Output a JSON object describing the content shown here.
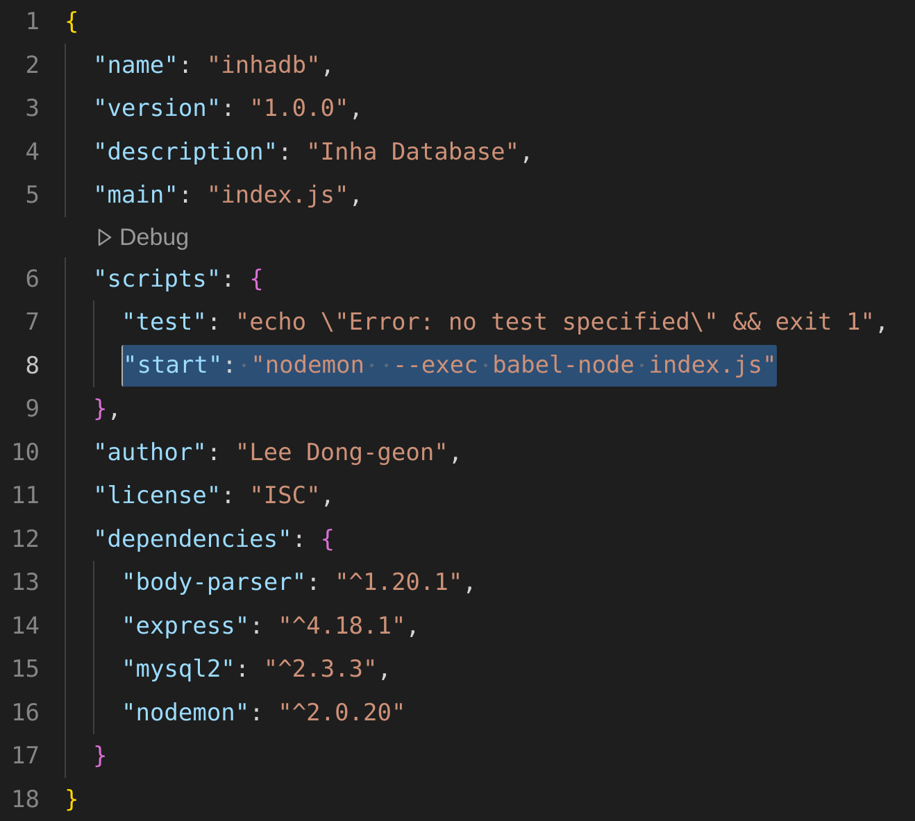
{
  "editor": {
    "file_language": "json",
    "active_line": 8,
    "codelens": {
      "after_line": 5,
      "icon": "play-outline-icon",
      "label": "Debug"
    },
    "colors": {
      "background": "#1e1e1e",
      "key": "#9cdcfe",
      "string": "#ce9178",
      "selection": "#2c4f76"
    },
    "lines": [
      {
        "n": "1",
        "indent": 0,
        "tokens": [
          {
            "t": "{",
            "c": "brace1"
          }
        ]
      },
      {
        "n": "2",
        "indent": 1,
        "tokens": [
          {
            "t": "\"name\"",
            "c": "key"
          },
          {
            "t": ": ",
            "c": "punct"
          },
          {
            "t": "\"inhadb\"",
            "c": "str"
          },
          {
            "t": ",",
            "c": "punct"
          }
        ]
      },
      {
        "n": "3",
        "indent": 1,
        "tokens": [
          {
            "t": "\"version\"",
            "c": "key"
          },
          {
            "t": ": ",
            "c": "punct"
          },
          {
            "t": "\"1.0.0\"",
            "c": "str"
          },
          {
            "t": ",",
            "c": "punct"
          }
        ]
      },
      {
        "n": "4",
        "indent": 1,
        "tokens": [
          {
            "t": "\"description\"",
            "c": "key"
          },
          {
            "t": ": ",
            "c": "punct"
          },
          {
            "t": "\"Inha Database\"",
            "c": "str"
          },
          {
            "t": ",",
            "c": "punct"
          }
        ]
      },
      {
        "n": "5",
        "indent": 1,
        "tokens": [
          {
            "t": "\"main\"",
            "c": "key"
          },
          {
            "t": ": ",
            "c": "punct"
          },
          {
            "t": "\"index.js\"",
            "c": "str"
          },
          {
            "t": ",",
            "c": "punct"
          }
        ]
      },
      {
        "n": "6",
        "indent": 1,
        "tokens": [
          {
            "t": "\"scripts\"",
            "c": "key"
          },
          {
            "t": ": ",
            "c": "punct"
          },
          {
            "t": "{",
            "c": "brace2"
          }
        ]
      },
      {
        "n": "7",
        "indent": 2,
        "tokens": [
          {
            "t": "\"test\"",
            "c": "key"
          },
          {
            "t": ": ",
            "c": "punct"
          },
          {
            "t": "\"echo \\\"Error: no test specified\\\" && exit 1\"",
            "c": "str"
          },
          {
            "t": ",",
            "c": "punct"
          }
        ]
      },
      {
        "n": "8",
        "indent": 2,
        "selected": true,
        "tokens": [
          {
            "t": "\"start\"",
            "c": "key"
          },
          {
            "t": ": ",
            "c": "punct"
          },
          {
            "t": "\"nodemon  --exec babel-node index.js\"",
            "c": "str"
          }
        ]
      },
      {
        "n": "9",
        "indent": 1,
        "tokens": [
          {
            "t": "}",
            "c": "brace2"
          },
          {
            "t": ",",
            "c": "punct"
          }
        ]
      },
      {
        "n": "10",
        "indent": 1,
        "tokens": [
          {
            "t": "\"author\"",
            "c": "key"
          },
          {
            "t": ": ",
            "c": "punct"
          },
          {
            "t": "\"Lee Dong-geon\"",
            "c": "str"
          },
          {
            "t": ",",
            "c": "punct"
          }
        ]
      },
      {
        "n": "11",
        "indent": 1,
        "tokens": [
          {
            "t": "\"license\"",
            "c": "key"
          },
          {
            "t": ": ",
            "c": "punct"
          },
          {
            "t": "\"ISC\"",
            "c": "str"
          },
          {
            "t": ",",
            "c": "punct"
          }
        ]
      },
      {
        "n": "12",
        "indent": 1,
        "tokens": [
          {
            "t": "\"dependencies\"",
            "c": "key"
          },
          {
            "t": ": ",
            "c": "punct"
          },
          {
            "t": "{",
            "c": "brace2"
          }
        ]
      },
      {
        "n": "13",
        "indent": 2,
        "tokens": [
          {
            "t": "\"body-parser\"",
            "c": "key"
          },
          {
            "t": ": ",
            "c": "punct"
          },
          {
            "t": "\"^1.20.1\"",
            "c": "str"
          },
          {
            "t": ",",
            "c": "punct"
          }
        ]
      },
      {
        "n": "14",
        "indent": 2,
        "tokens": [
          {
            "t": "\"express\"",
            "c": "key"
          },
          {
            "t": ": ",
            "c": "punct"
          },
          {
            "t": "\"^4.18.1\"",
            "c": "str"
          },
          {
            "t": ",",
            "c": "punct"
          }
        ]
      },
      {
        "n": "15",
        "indent": 2,
        "tokens": [
          {
            "t": "\"mysql2\"",
            "c": "key"
          },
          {
            "t": ": ",
            "c": "punct"
          },
          {
            "t": "\"^2.3.3\"",
            "c": "str"
          },
          {
            "t": ",",
            "c": "punct"
          }
        ]
      },
      {
        "n": "16",
        "indent": 2,
        "tokens": [
          {
            "t": "\"nodemon\"",
            "c": "key"
          },
          {
            "t": ": ",
            "c": "punct"
          },
          {
            "t": "\"^2.0.20\"",
            "c": "str"
          }
        ]
      },
      {
        "n": "17",
        "indent": 1,
        "tokens": [
          {
            "t": "}",
            "c": "brace2"
          }
        ]
      },
      {
        "n": "18",
        "indent": 0,
        "tokens": [
          {
            "t": "}",
            "c": "brace1"
          }
        ]
      }
    ]
  }
}
